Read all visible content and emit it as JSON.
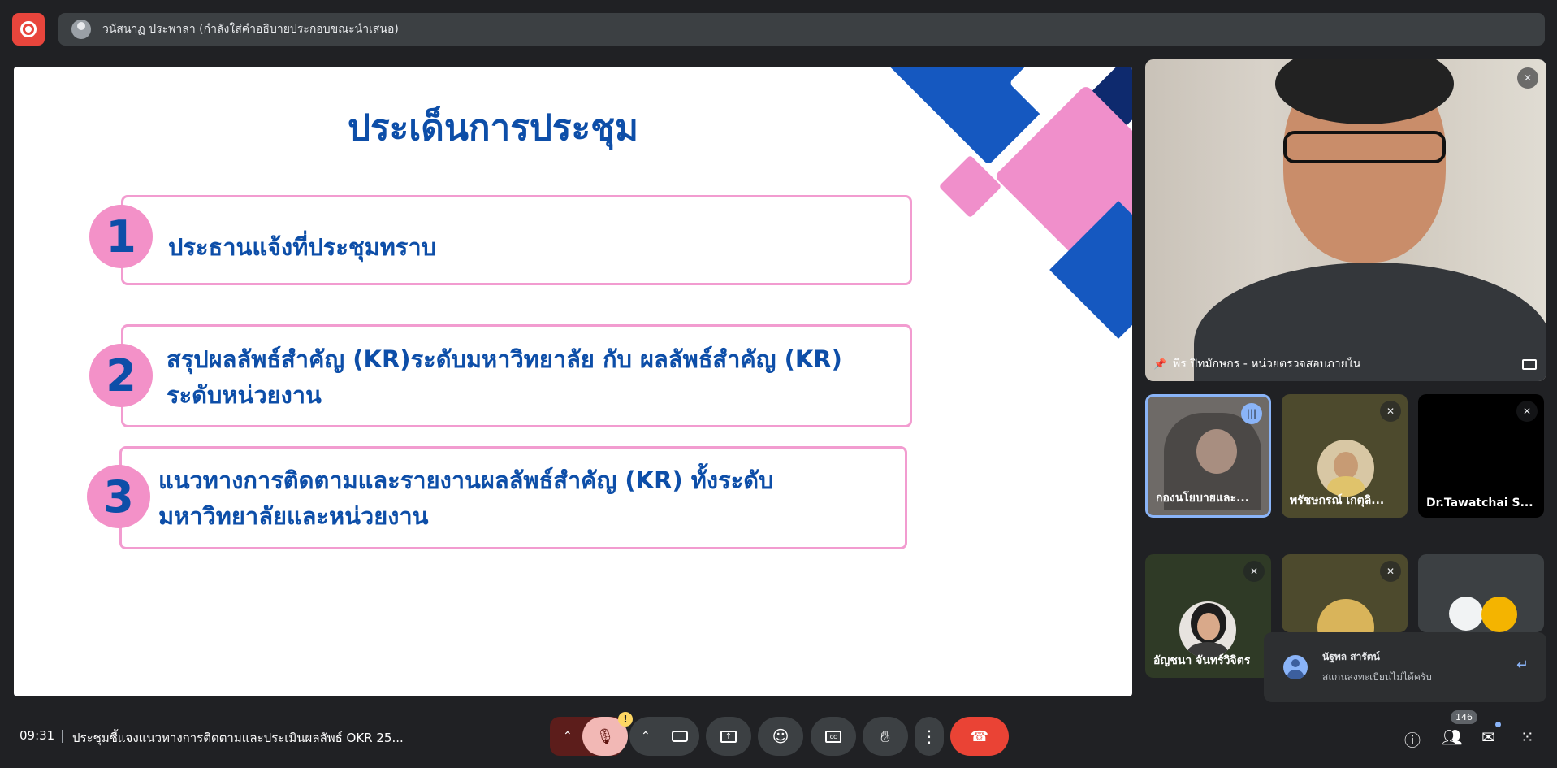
{
  "topbar": {
    "presenter_label": "วนัสนาฏ ประพาลา (กำลังใส่คำอธิบายประกอบขณะนำเสนอ)"
  },
  "slide": {
    "title": "ประเด็นการประชุม",
    "items": [
      {
        "number": "1",
        "text_lines": [
          "ประธานแจ้งที่ประชุมทราบ"
        ]
      },
      {
        "number": "2",
        "text_lines": [
          "สรุปผลลัพธ์สำคัญ (KR)ระดับมหาวิทยาลัย กับ ผลลัพธ์สำคัญ (KR)",
          "ระดับหน่วยงาน"
        ]
      },
      {
        "number": "3",
        "text_lines": [
          "แนวทางการติดตามและรายงานผลลัพธ์สำคัญ (KR) ทั้งระดับ",
          "มหาวิทยาลัยและหน่วยงาน"
        ]
      }
    ]
  },
  "participants": {
    "pinned": {
      "name": "พีร ปิทมักษกร - หน่วยตรวจสอบภายใน"
    },
    "tiles": [
      {
        "name": "กองนโยบายและ..."
      },
      {
        "name": "พรัชษกรณ์ เกตุลิ..."
      },
      {
        "name": "Dr.Tawatchai S..."
      },
      {
        "name": "อัญชนา จันทร์วิจิตร"
      },
      {
        "name": ""
      },
      {
        "name": ""
      }
    ]
  },
  "chat_toast": {
    "sender": "นัฐพล สารัตน์",
    "message": "สแกนลงทะเบียนไม่ได้ครับ"
  },
  "bottombar": {
    "time": "09:31",
    "meeting_title": "ประชุมชี้แจงแนวทางการติดตามและประเมินผลลัพธ์ OKR 25...",
    "participant_count": "146",
    "mic_warning": "!"
  },
  "colors": {
    "slide_blue": "#0d4ea8",
    "slide_pink": "#f391c8",
    "end_call": "#ea4335",
    "record": "#e8453c"
  }
}
